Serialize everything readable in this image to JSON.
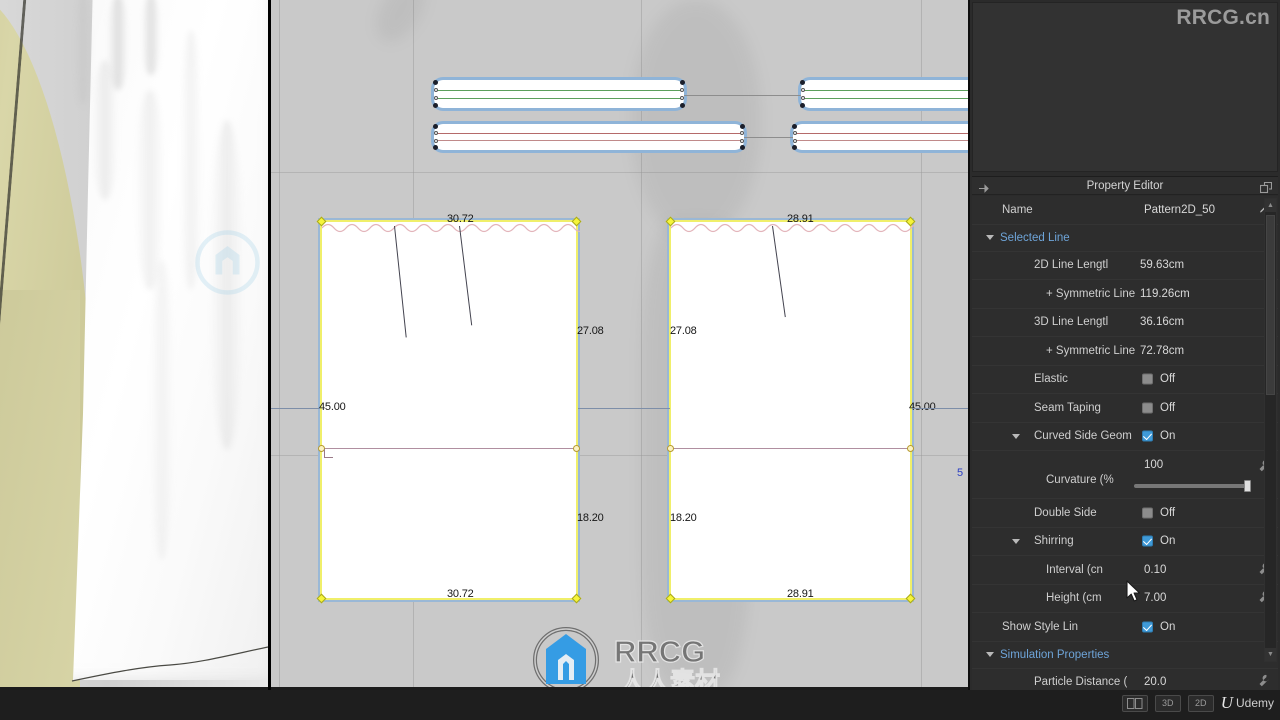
{
  "app": {
    "watermark_corner": "RRCG.cn",
    "watermark_center_latin": "RRCG",
    "watermark_center_cjk": "人人素材"
  },
  "panel": {
    "title": "Property Editor",
    "pin_icon": "pin-icon",
    "float_icon": "float-window-icon",
    "scroll_up_icon": "chevron-up-icon",
    "scroll_down_icon": "chevron-down-icon"
  },
  "properties": {
    "name_label": "Name",
    "name_value": "Pattern2D_50",
    "edit_icon": "pencil-icon",
    "groups": [
      {
        "label": "Selected Line",
        "expanded": true,
        "rows": [
          {
            "label": "2D Line Lengtl",
            "value": "59.63cm",
            "indent": 2,
            "type": "text"
          },
          {
            "label": "+ Symmetric Line",
            "value": "119.26cm",
            "indent": 2,
            "type": "text"
          },
          {
            "label": "3D Line Lengtl",
            "value": "36.16cm",
            "indent": 2,
            "type": "text"
          },
          {
            "label": "+ Symmetric Line",
            "value": "72.78cm",
            "indent": 2,
            "type": "text"
          },
          {
            "label": "Elastic",
            "value": "Off",
            "indent": 2,
            "type": "check",
            "checked": false
          },
          {
            "label": "Seam Taping",
            "value": "Off",
            "indent": 2,
            "type": "check",
            "checked": false
          }
        ]
      },
      {
        "label": "Curved Side Geom",
        "expanded": true,
        "indent": 1,
        "value": "On",
        "checked": true,
        "rows": [
          {
            "label": "Curvature (%",
            "value": "100",
            "indent": 3,
            "type": "slider",
            "slider_pct": 97,
            "wrench": true
          },
          {
            "label": "Double Side",
            "value": "Off",
            "indent": 2,
            "type": "check",
            "checked": false
          }
        ]
      },
      {
        "label": "Shirring",
        "expanded": true,
        "indent": 1,
        "value": "On",
        "checked": true,
        "rows": [
          {
            "label": "Interval (cn",
            "value": "0.10",
            "indent": 3,
            "type": "text",
            "wrench": true
          },
          {
            "label": "Height (cm",
            "value": "7.00",
            "indent": 3,
            "type": "text",
            "wrench": true
          }
        ]
      },
      {
        "label": "Show Style Lin",
        "expanded": false,
        "flat": true,
        "rows": [
          {
            "label": "Show Style Lin",
            "value": "On",
            "indent": 2,
            "type": "check",
            "checked": true
          }
        ]
      },
      {
        "label": "Simulation Properties",
        "expanded": true,
        "rows": [
          {
            "label": "Particle Distance (",
            "value": "20.0",
            "indent": 2,
            "type": "text",
            "wrench": true
          }
        ]
      }
    ]
  },
  "pattern_left": {
    "top_dim": "30.72",
    "bottom_dim": "30.72",
    "right_upper_dim": "27.08",
    "right_lower_dim": "18.20",
    "left_dim": "45.00"
  },
  "pattern_right": {
    "top_dim": "28.91",
    "bottom_dim": "28.91",
    "left_upper_dim": "27.08",
    "left_lower_dim": "18.20",
    "right_dim": "45.00",
    "edge_label": "5"
  },
  "bottom_bar": {
    "split_view_icon": "split-view-icon",
    "view_3d": "3D",
    "view_2d": "2D",
    "brand": "Udemy",
    "brand_mark": "U"
  },
  "colors": {
    "panel_bg": "#2d2d2d",
    "group_text": "#6ea4d8",
    "checkbox_on": "#3f9ad8",
    "pattern_outline": "#f0ef6a",
    "pattern_glow": "#9ab8d6",
    "viewport2d_bg": "#c9c9c9"
  }
}
